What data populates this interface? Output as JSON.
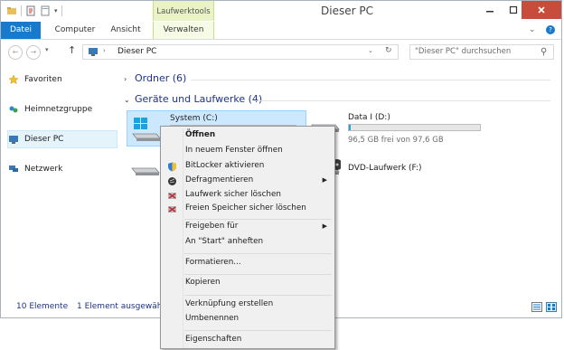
{
  "window": {
    "title": "Dieser PC",
    "contextual_tab_group": "Laufwerktools"
  },
  "ribbon": {
    "tabs": [
      {
        "label": "Datei"
      },
      {
        "label": "Computer"
      },
      {
        "label": "Ansicht"
      },
      {
        "label": "Verwalten"
      }
    ]
  },
  "address": {
    "path_item": "Dieser PC",
    "search_placeholder": "\"Dieser PC\" durchsuchen"
  },
  "nav": {
    "items": [
      {
        "label": "Favoriten",
        "icon": "star-icon"
      },
      {
        "label": "Heimnetzgruppe",
        "icon": "homegroup-icon"
      },
      {
        "label": "Dieser PC",
        "icon": "computer-icon"
      },
      {
        "label": "Netzwerk",
        "icon": "network-icon"
      }
    ]
  },
  "content": {
    "group_folders": "Ordner (6)",
    "group_devices": "Geräte und Laufwerke (4)",
    "drives": [
      {
        "name": "System (C:)",
        "icon": "windows-drive-icon"
      },
      {
        "name": "Data I (D:)",
        "free": "96,5 GB frei von 97,6 GB",
        "used_fraction": 0.011,
        "icon": "hard-drive-icon"
      },
      {
        "name": "DVD-Laufwerk (F:)",
        "icon": "dvd-drive-icon"
      }
    ]
  },
  "status": {
    "count": "10 Elemente",
    "selection": "1 Element ausgewählt"
  },
  "context_menu": {
    "items": [
      {
        "label": "Öffnen",
        "bold": true
      },
      {
        "label": "In neuem Fenster öffnen"
      },
      {
        "label": "BitLocker aktivieren",
        "icon": "shield-icon"
      },
      {
        "label": "Defragmentieren",
        "submenu": true,
        "icon": "defrag-icon"
      },
      {
        "label": "Laufwerk sicher löschen",
        "icon": "eraser-icon"
      },
      {
        "label": "Freien Speicher sicher löschen",
        "icon": "eraser-icon"
      },
      {
        "label": "Freigeben für",
        "submenu": true
      },
      {
        "label": "An \"Start\" anheften"
      },
      {
        "label": "Formatieren..."
      },
      {
        "label": "Kopieren"
      },
      {
        "label": "Verknüpfung erstellen"
      },
      {
        "label": "Umbenennen"
      },
      {
        "label": "Eigenschaften"
      }
    ]
  },
  "colors": {
    "accent": "#1979ca",
    "selection": "#cce8ff",
    "progress": "#26a0da",
    "close": "#c74c3c"
  }
}
